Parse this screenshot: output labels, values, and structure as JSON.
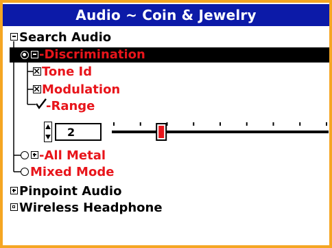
{
  "window": {
    "title": "Audio ~ Coin & Jewelry"
  },
  "colors": {
    "frame": "#f5a623",
    "titlebar": "#0c1aa8",
    "accent_red": "#e8151b",
    "selection": "#000000"
  },
  "tree": {
    "search_audio": {
      "label": "Search Audio",
      "icon": "minus-box-icon"
    },
    "discrimination": {
      "label": "-Discrimination",
      "icon": "radio-selected-icon",
      "expander": "minus-box-icon",
      "selected": true
    },
    "tone_id": {
      "label": "Tone Id",
      "icon": "checkbox-x-icon"
    },
    "modulation": {
      "label": "Modulation",
      "icon": "checkbox-x-icon"
    },
    "range": {
      "label": "-Range",
      "icon": "checkmark-icon"
    },
    "range_control": {
      "value": "2",
      "slider_fraction": 0.22,
      "tick_count": 9
    },
    "all_metal": {
      "label": "-All Metal",
      "icon": "radio-icon",
      "expander": "plus-box-icon"
    },
    "mixed_mode": {
      "label": "Mixed Mode",
      "icon": "radio-icon"
    },
    "pinpoint_audio": {
      "label": "Pinpoint Audio",
      "icon": "plus-box-icon"
    },
    "wireless_headphone": {
      "label": "Wireless Headphone",
      "icon": "square-box-icon"
    }
  }
}
